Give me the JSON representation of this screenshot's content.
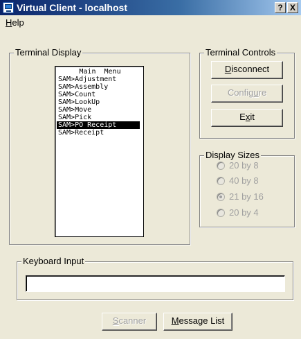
{
  "window": {
    "title": "Virtual Client - localhost",
    "help_button": "?",
    "close_button": "X"
  },
  "menu": {
    "help": "Help"
  },
  "terminal_display": {
    "legend": "Terminal Display",
    "title_line": "Main  Menu",
    "lines": [
      "SAM>Adjustment",
      "SAM>Assembly",
      "SAM>Count",
      "SAM>LookUp",
      "SAM>Move",
      "SAM>Pick",
      "SAM>PO Receipt",
      "SAM>Receipt"
    ],
    "selected_line": "SAM>PO Receipt"
  },
  "terminal_controls": {
    "legend": "Terminal Controls",
    "disconnect": "Disconnect",
    "configure": "Configure",
    "exit": "Exit"
  },
  "display_sizes": {
    "legend": "Display Sizes",
    "options": [
      {
        "label": "20 by 8",
        "checked": false
      },
      {
        "label": "40 by 8",
        "checked": false
      },
      {
        "label": "21 by 16",
        "checked": true
      },
      {
        "label": "20 by 4",
        "checked": false
      }
    ]
  },
  "keyboard_input": {
    "legend": "Keyboard Input",
    "value": ""
  },
  "bottom_buttons": {
    "scanner": "Scanner",
    "message_list": "Message List"
  },
  "colors": {
    "title_bar_start": "#0a246a",
    "window_background": "#ece9d8",
    "disabled_text": "#a0a0a0"
  }
}
